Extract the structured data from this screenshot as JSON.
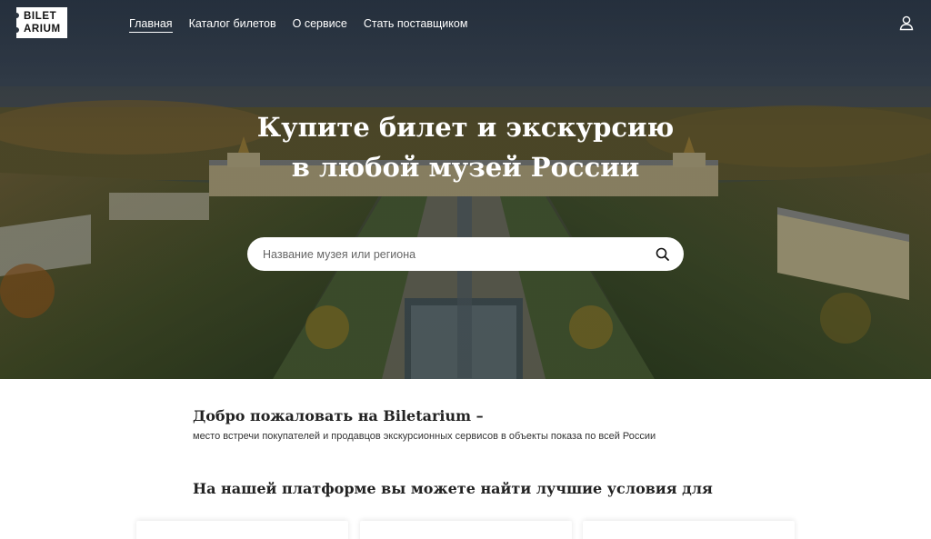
{
  "logo": {
    "line1": "BILET",
    "line2": "ARIUM"
  },
  "nav": {
    "items": [
      {
        "label": "Главная",
        "active": true
      },
      {
        "label": "Каталог билетов",
        "active": false
      },
      {
        "label": "О сервисе",
        "active": false
      },
      {
        "label": "Стать поставщиком",
        "active": false
      }
    ],
    "user_icon": "user-icon"
  },
  "hero": {
    "title_line1": "Купите билет и экскурсию",
    "title_line2": "в любой музей России",
    "search": {
      "placeholder": "Название музея или региона",
      "value": "",
      "icon": "search-icon"
    }
  },
  "welcome": {
    "title": "Добро пожаловать на Biletarium –",
    "subtitle": "место встречи покупателей и продавцов экскурсионных сервисов в объекты показа по всей России"
  },
  "platform": {
    "title": "На нашей платформе вы можете найти лучшие условия для"
  },
  "colors": {
    "hero_text": "#ffffff",
    "search_bg": "#ffffff",
    "body_text": "#222222",
    "logo_bg": "#ffffff"
  }
}
